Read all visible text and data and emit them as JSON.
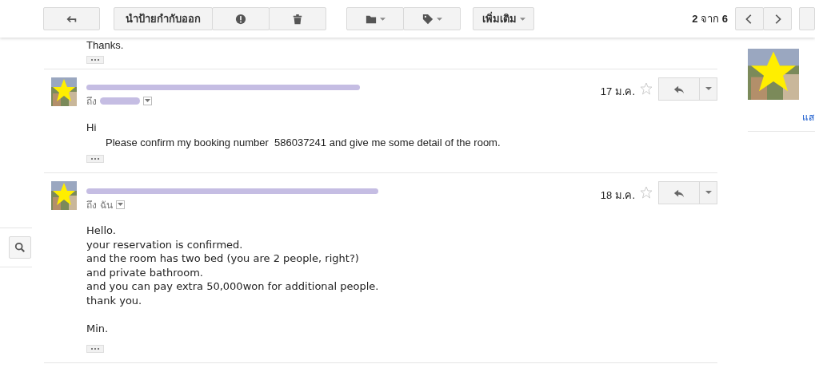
{
  "toolbar": {
    "remove_label": "นำป้ายกำกับออก",
    "more": "เพิ่มเติม",
    "pager": "**2** จาก **6**"
  },
  "previous_message": {
    "text": "Thanks."
  },
  "messages": [
    {
      "kind": "html",
      "recipient_prefix": "ถึง",
      "date": "17 ม.ค.",
      "starred": false,
      "body": [
        {
          "text": "Hi",
          "indent": false
        },
        {
          "text": "Please confirm my booking number  586037241 and give me some detail of the room.",
          "indent": true
        }
      ]
    },
    {
      "kind": "plain",
      "recipient_prefix": "ถึง",
      "recipient": "ฉัน",
      "date": "18 ม.ค.",
      "starred": false,
      "body": [
        {
          "text": "Hello.",
          "indent": false
        },
        {
          "text": "your reservation is confirmed.",
          "indent": false
        },
        {
          "text": "and the room has two bed (you are 2 people, right?)",
          "indent": false
        },
        {
          "text": "and private bathroom.",
          "indent": false
        },
        {
          "text": "and you can pay extra 50,000won for additional people.",
          "indent": false
        },
        {
          "text": "thank you.",
          "indent": false
        }
      ],
      "signature": "Min."
    }
  ],
  "sidebar": {
    "link": "แส"
  }
}
